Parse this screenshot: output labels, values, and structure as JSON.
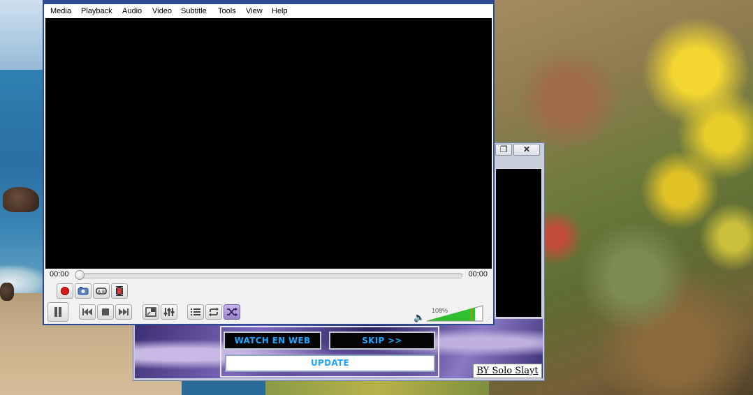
{
  "vlc": {
    "menu": [
      "Media",
      "Playback",
      "Audio",
      "Video",
      "Subtitle",
      "Tools",
      "View",
      "Help"
    ],
    "time_current": "00:00",
    "time_total": "00:00",
    "seek_position": 0,
    "volume_label": "108%",
    "volume_level": 1.08,
    "buttons": {
      "record": "record-icon",
      "snapshot": "camera-icon",
      "loop_ab": "loop-ab-icon",
      "frame_by_frame": "frame-step-icon",
      "pause": "pause-icon",
      "previous": "previous-icon",
      "stop": "stop-icon",
      "next": "next-icon",
      "fullscreen": "fullscreen-icon",
      "extended_settings": "equalizer-icon",
      "playlist": "playlist-icon",
      "loop": "loop-icon",
      "random": "shuffle-icon"
    }
  },
  "installer": {
    "watch_label": "WATCH EN WEB",
    "skip_label": "SKIP >>",
    "update_label": "UPDATE",
    "credit": "BY Solo Slayt",
    "close_glyph": "✕",
    "restore_glyph": "❐"
  },
  "colors": {
    "vlc_frame": "#2c4a94",
    "button_text": "#1fa6ff",
    "volume_green": "#2fc02f"
  }
}
